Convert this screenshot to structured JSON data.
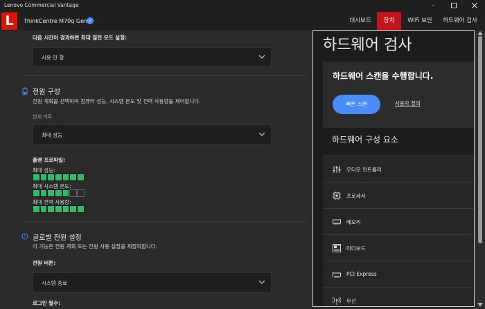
{
  "window": {
    "title": "Lenovo Commercial Vantage"
  },
  "header": {
    "logo_letter": "L",
    "device_name": "ThinkCentre M70q Gen 3",
    "nav": [
      "대시보드",
      "장치",
      "WiFi 보안",
      "하드웨어 검사"
    ],
    "active_nav_index": 1,
    "accent_color": "#c0151b"
  },
  "settings": {
    "sleep_label": "다음 시간이 경과하면 최대 절전 모드 설정:",
    "sleep_value": "사용 안 함",
    "power_plan": {
      "title": "전원 구성",
      "description": "전원 계획을 선택하여 컴퓨터 성능, 시스템 온도 및 전력 사용량을 제어합니다.",
      "current_label": "현재 계획",
      "current_value": "최대 성능",
      "profile_label": "플랜 프로파일:",
      "profiles": [
        {
          "label": "최대 성능:",
          "level": 7,
          "max": 7
        },
        {
          "label": "최대 시스템 온도:",
          "level": 5,
          "max": 7
        },
        {
          "label": "최대 전력 사용량:",
          "level": 7,
          "max": 7
        }
      ]
    },
    "global_power": {
      "title": "글로벌 전원 설정",
      "description": "이 기능은 전원 계획 또는 전원 사용 설정을 재정의합니다.",
      "power_button_label": "전원 버튼:",
      "power_button_value": "시스템 종료",
      "login_label": "로그인 필수:"
    }
  },
  "hardware_scan": {
    "title": "하드웨어 검사",
    "card_title": "하드웨어 스캔을 수행합니다.",
    "quick_scan_label": "빠른 스캔",
    "custom_label": "사용자 정의",
    "components_title": "하드웨어 구성 요소",
    "components": [
      {
        "label": "오디오 컨트롤러",
        "icon": "audio-controller-icon"
      },
      {
        "label": "프로세서",
        "icon": "processor-icon"
      },
      {
        "label": "메모리",
        "icon": "memory-icon"
      },
      {
        "label": "마더보드",
        "icon": "motherboard-icon"
      },
      {
        "label": "PCI Express",
        "icon": "pci-express-icon"
      },
      {
        "label": "무선",
        "icon": "wireless-icon"
      }
    ]
  },
  "colors": {
    "bar_on": "#2fbb6c",
    "button_blue": "#4a8cf7"
  }
}
